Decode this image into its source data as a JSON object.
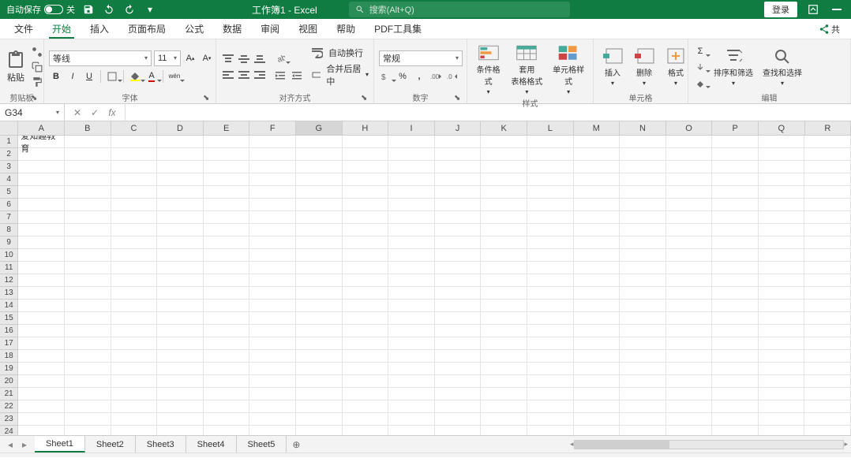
{
  "titlebar": {
    "autosave_label": "自动保存",
    "autosave_state": "关",
    "doc_title": "工作簿1 - Excel",
    "search_placeholder": "搜索(Alt+Q)",
    "login_label": "登录"
  },
  "menubar": {
    "items": [
      "文件",
      "开始",
      "插入",
      "页面布局",
      "公式",
      "数据",
      "审阅",
      "视图",
      "帮助",
      "PDF工具集"
    ],
    "share_label": "共"
  },
  "ribbon": {
    "clipboard": {
      "paste": "粘贴",
      "label": "剪贴板"
    },
    "font": {
      "name": "等线",
      "size": "11",
      "label": "字体"
    },
    "alignment": {
      "wrap": "自动换行",
      "merge": "合并后居中",
      "label": "对齐方式"
    },
    "number": {
      "format": "常规",
      "label": "数字"
    },
    "styles": {
      "cond": "条件格式",
      "table": "套用\n表格格式",
      "cell": "单元格样式",
      "label": "样式"
    },
    "cells": {
      "insert": "插入",
      "delete": "删除",
      "format": "格式",
      "label": "单元格"
    },
    "editing": {
      "sort": "排序和筛选",
      "find": "查找和选择",
      "label": "编辑"
    }
  },
  "namebox": "G34",
  "columns": [
    "A",
    "B",
    "C",
    "D",
    "E",
    "F",
    "G",
    "H",
    "I",
    "J",
    "K",
    "L",
    "M",
    "N",
    "O",
    "P",
    "Q",
    "R"
  ],
  "selected_col": "G",
  "row_count": 25,
  "cells": {
    "A1": "爱知趣教育"
  },
  "sheets": [
    "Sheet1",
    "Sheet2",
    "Sheet3",
    "Sheet4",
    "Sheet5"
  ],
  "active_sheet": "Sheet1"
}
